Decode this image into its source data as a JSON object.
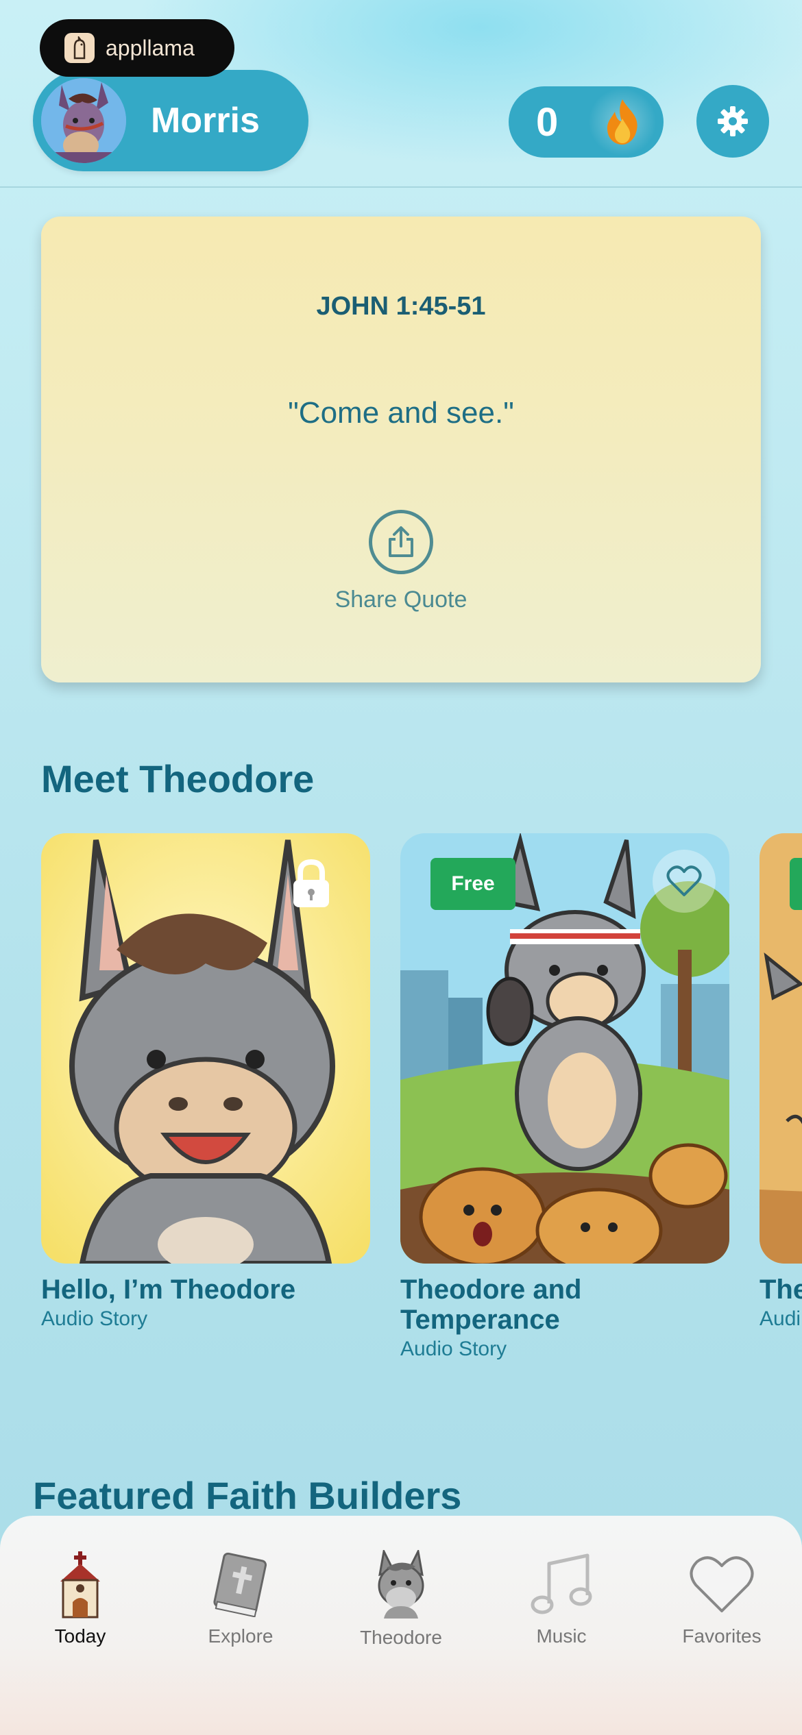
{
  "app_badge": {
    "label": "appllama"
  },
  "header": {
    "profile_name": "Morris",
    "streak_count": "0",
    "icons": {
      "flame": "flame-icon",
      "settings": "gear-icon"
    }
  },
  "quote_card": {
    "reference": "JOHN 1:45-51",
    "text": "\"Come and see.\"",
    "share_label": "Share Quote"
  },
  "sections": {
    "meet_title": "Meet Theodore",
    "featured_title": "Featured Faith Builders"
  },
  "cards": [
    {
      "title": "Hello, I’m Theodore",
      "subtitle": "Audio Story",
      "locked": true
    },
    {
      "title": "Theodore and Temperance",
      "subtitle": "Audio Story",
      "badge": "Free"
    },
    {
      "title": "The Yap",
      "subtitle": "Audi"
    }
  ],
  "tabs": [
    {
      "label": "Today",
      "icon": "church-icon"
    },
    {
      "label": "Explore",
      "icon": "bible-icon"
    },
    {
      "label": "Theodore",
      "icon": "donkey-icon"
    },
    {
      "label": "Music",
      "icon": "music-note-icon"
    },
    {
      "label": "Favorites",
      "icon": "heart-icon"
    }
  ],
  "colors": {
    "accent": "#34a9c6",
    "title": "#13657e",
    "free_badge": "#23a85a"
  }
}
